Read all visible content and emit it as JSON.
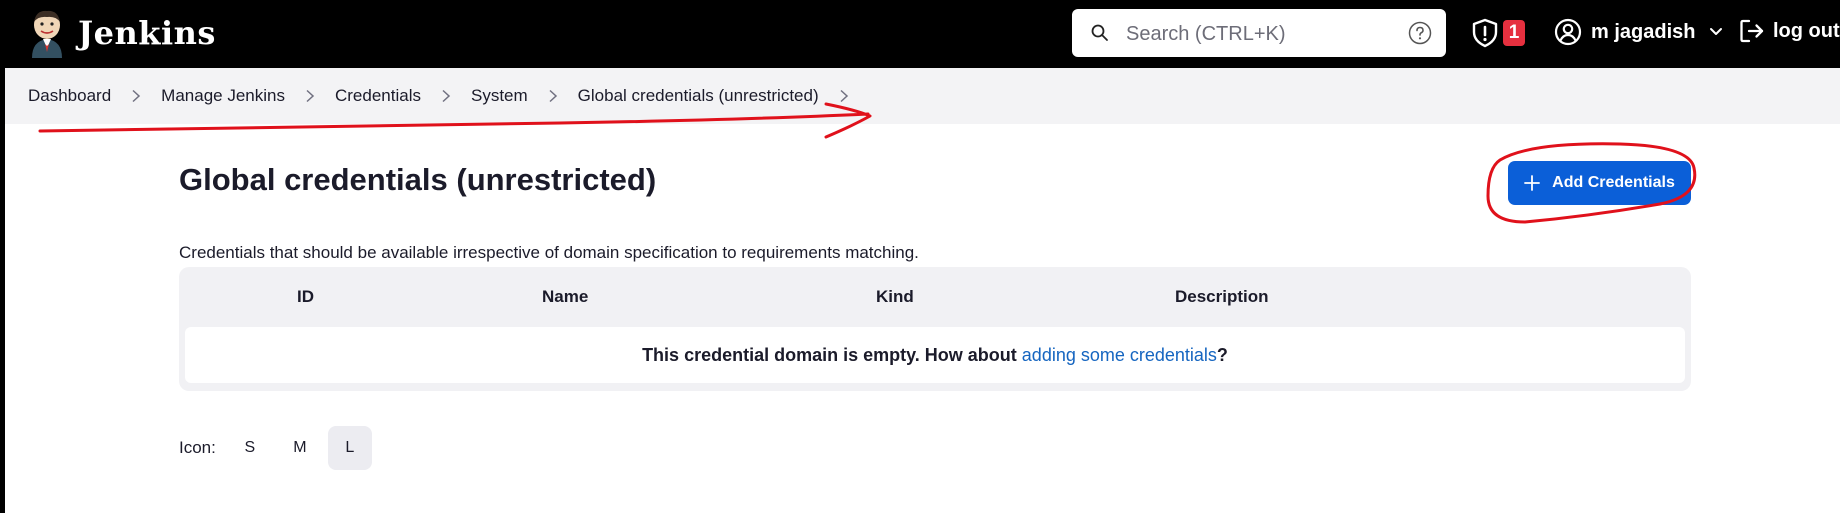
{
  "header": {
    "brand": "Jenkins",
    "search_placeholder": "Search (CTRL+K)",
    "security_badge": "1",
    "user_name": "m jagadish",
    "logout_label": "log out"
  },
  "breadcrumb": [
    "Dashboard",
    "Manage Jenkins",
    "Credentials",
    "System",
    "Global credentials (unrestricted)"
  ],
  "main": {
    "title": "Global credentials (unrestricted)",
    "add_button": "Add Credentials",
    "description": "Credentials that should be available irrespective of domain specification to requirements matching.",
    "table": {
      "columns": [
        "ID",
        "Name",
        "Kind",
        "Description"
      ],
      "empty_text": "This credential domain is empty. How about ",
      "empty_link": "adding some credentials",
      "empty_suffix": "?"
    },
    "icon_size": {
      "label": "Icon:",
      "options": [
        "S",
        "M",
        "L"
      ],
      "selected": "L"
    }
  },
  "colors": {
    "header_bg": "#000000",
    "primary_button": "#0b5fd8",
    "badge": "#e6303f",
    "link": "#1565c0",
    "annotation_red": "#e0111b"
  }
}
